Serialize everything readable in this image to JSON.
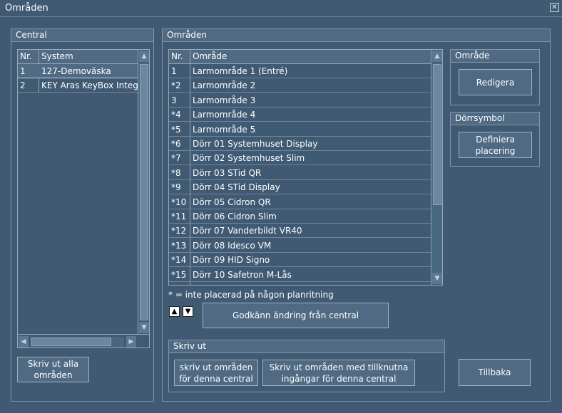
{
  "window": {
    "title": "Områden",
    "close_glyph": "✕"
  },
  "central": {
    "header": "Central",
    "columns": {
      "nr": "Nr.",
      "system": "System"
    },
    "rows": [
      {
        "nr": "1",
        "system": "127-Demoväska",
        "selected": true
      },
      {
        "nr": "2",
        "system": "KEY Aras KeyBox Integr",
        "selected": false
      }
    ],
    "print_all_label_1": "Skriv ut alla",
    "print_all_label_2": "områden"
  },
  "omraden": {
    "header": "Områden",
    "columns": {
      "nr": "Nr.",
      "omrade": "Område"
    },
    "rows": [
      {
        "nr": "1",
        "name": "Larmområde 1 (Entré)"
      },
      {
        "nr": "*2",
        "name": "Larmområde 2"
      },
      {
        "nr": "3",
        "name": "Larmområde 3"
      },
      {
        "nr": "*4",
        "name": "Larmområde 4"
      },
      {
        "nr": "*5",
        "name": "Larmområde 5"
      },
      {
        "nr": "*6",
        "name": "Dörr 01 Systemhuset Display"
      },
      {
        "nr": "*7",
        "name": "Dörr 02 Systemhuset Slim"
      },
      {
        "nr": "*8",
        "name": "Dörr 03 STid QR"
      },
      {
        "nr": "*9",
        "name": "Dörr 04 STid Display"
      },
      {
        "nr": "*10",
        "name": "Dörr 05 Cidron QR"
      },
      {
        "nr": "*11",
        "name": "Dörr 06 Cidron Slim"
      },
      {
        "nr": "*12",
        "name": "Dörr 07 Vanderbildt VR40"
      },
      {
        "nr": "*13",
        "name": "Dörr 08 Idesco VM"
      },
      {
        "nr": "*14",
        "name": "Dörr 09 HID Signo"
      },
      {
        "nr": "*15",
        "name": "Dörr 10 Safetron M-Lås"
      }
    ],
    "note": "* = inte placerad på någon planritning",
    "approve_label": "Godkänn ändring från central"
  },
  "omrade_group": {
    "header": "Område",
    "edit_label": "Redigera"
  },
  "door_group": {
    "header": "Dörrsymbol",
    "define_label_1": "Definiera",
    "define_label_2": "placering"
  },
  "print_group": {
    "header": "Skriv ut",
    "print_areas_1": "skriv ut områden",
    "print_areas_2": "för denna central",
    "print_inputs_1": "Skriv ut områden med tillknutna",
    "print_inputs_2": "ingångar för denna central"
  },
  "back_label": "Tillbaka",
  "glyphs": {
    "up": "▲",
    "down": "▼",
    "left": "◀",
    "right": "▶"
  }
}
